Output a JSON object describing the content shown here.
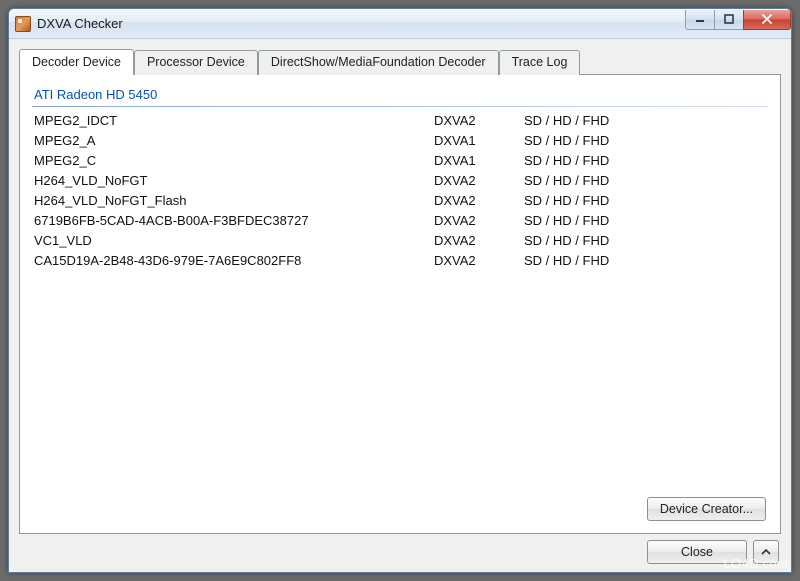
{
  "window": {
    "title": "DXVA Checker"
  },
  "tabs": [
    {
      "label": "Decoder Device",
      "active": true
    },
    {
      "label": "Processor Device",
      "active": false
    },
    {
      "label": "DirectShow/MediaFoundation Decoder",
      "active": false
    },
    {
      "label": "Trace Log",
      "active": false
    }
  ],
  "decoder": {
    "device_name": "ATI Radeon HD 5450",
    "rows": [
      {
        "name": "MPEG2_IDCT",
        "api": "DXVA2",
        "res": "SD / HD / FHD"
      },
      {
        "name": "MPEG2_A",
        "api": "DXVA1",
        "res": "SD / HD / FHD"
      },
      {
        "name": "MPEG2_C",
        "api": "DXVA1",
        "res": "SD / HD / FHD"
      },
      {
        "name": "H264_VLD_NoFGT",
        "api": "DXVA2",
        "res": "SD / HD / FHD"
      },
      {
        "name": "H264_VLD_NoFGT_Flash",
        "api": "DXVA2",
        "res": "SD / HD / FHD"
      },
      {
        "name": "6719B6FB-5CAD-4ACB-B00A-F3BFDEC38727",
        "api": "DXVA2",
        "res": "SD / HD / FHD"
      },
      {
        "name": "VC1_VLD",
        "api": "DXVA2",
        "res": "SD / HD / FHD"
      },
      {
        "name": "CA15D19A-2B48-43D6-979E-7A6E9C802FF8",
        "api": "DXVA2",
        "res": "SD / HD / FHD"
      }
    ]
  },
  "buttons": {
    "device_creator": "Device Creator...",
    "close": "Close"
  },
  "watermark": "LO4D.com"
}
